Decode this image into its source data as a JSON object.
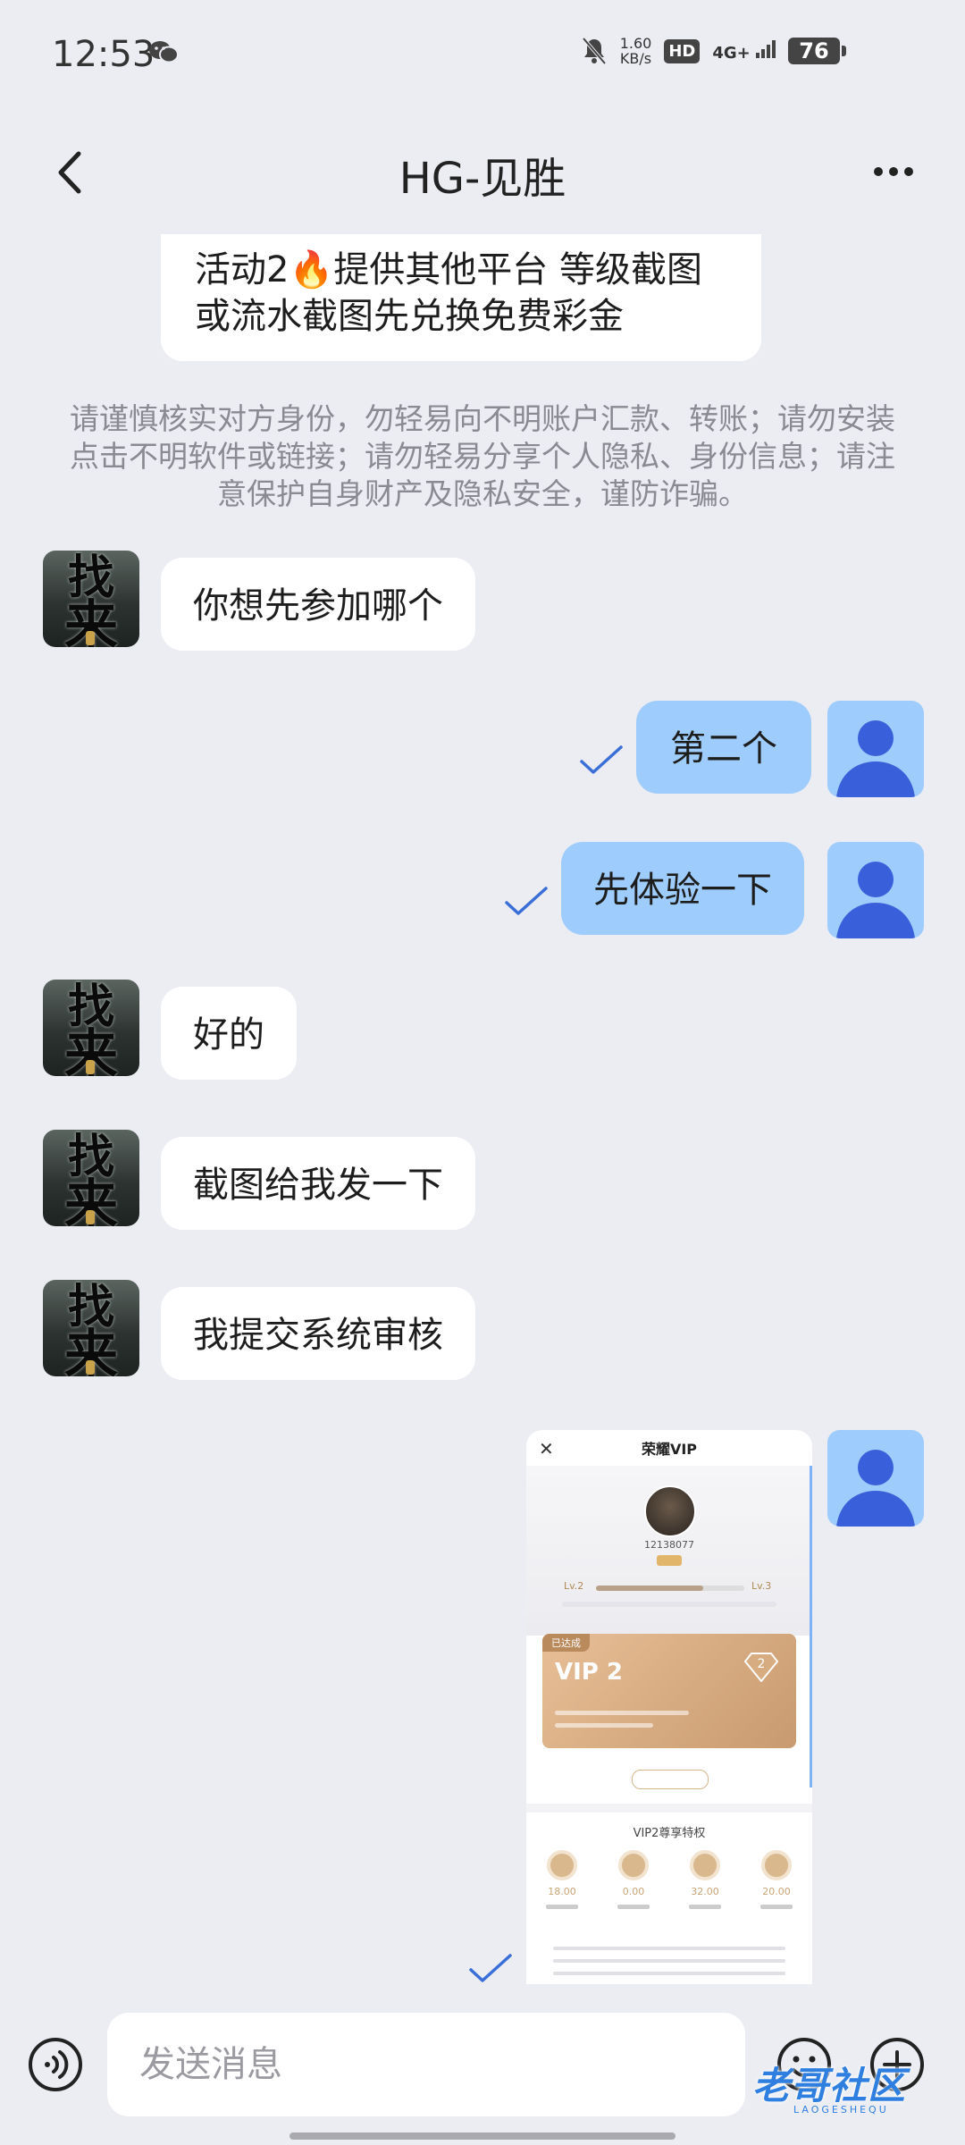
{
  "status_bar": {
    "time": "12:53",
    "net_speed_value": "1.60",
    "net_speed_unit": "KB/s",
    "hd_badge": "HD",
    "network": "4G+",
    "battery": "76"
  },
  "header": {
    "title": "HG-见胜"
  },
  "messages": {
    "top_partial": "活动2🔥提供其他平台 等级截图或流水截图先兑换免费彩金",
    "notice": "请谨慎核实对方身份，勿轻易向不明账户汇款、转账；请勿安装点击不明软件或链接；请勿轻易分享个人隐私、身份信息；请注意保护自身财产及隐私安全，谨防诈骗。",
    "m1": "你想先参加哪个",
    "m2": "第二个",
    "m3": "先体验一下",
    "m4": "好的",
    "m5": "截图给我发一下",
    "m6": "我提交系统审核",
    "avatar_text_1": "找",
    "avatar_text_2": "来"
  },
  "screenshot_message": {
    "header_title": "荣耀VIP",
    "user_id": "12138077",
    "level_from": "Lv.2",
    "level_to": "Lv.3",
    "achieved_tag": "已达成",
    "vip_label": "VIP 2",
    "gem_number": "2",
    "perks_title": "VIP2尊享特权",
    "perks": [
      {
        "value": "18.00"
      },
      {
        "value": "0.00"
      },
      {
        "value": "32.00"
      },
      {
        "value": "20.00"
      }
    ]
  },
  "composer": {
    "placeholder": "发送消息"
  },
  "watermark": {
    "text": "老哥社区",
    "sub": "LAOGESHEQU"
  },
  "colors": {
    "background": "#ECEDF3",
    "outgoing_bubble": "#9ECCFC",
    "incoming_bubble": "#FFFFFF",
    "check": "#3B6FD8",
    "avatar_figure": "#3A5FDB"
  }
}
